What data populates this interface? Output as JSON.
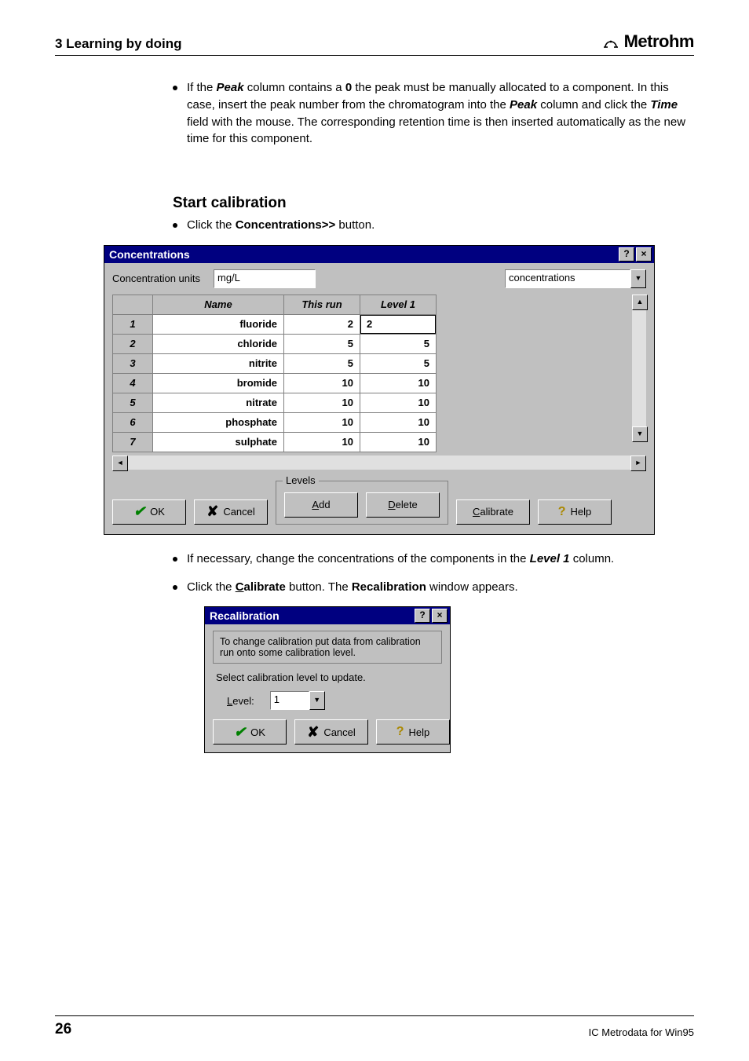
{
  "header": {
    "section": "3  Learning by doing",
    "brand": "Metrohm"
  },
  "para1": {
    "pre": "If the ",
    "peak": "Peak",
    "mid1": " column contains a ",
    "zero": "0",
    "mid2": " the peak must be manually allocated to a component. In this case, insert the peak number from the chromatogram into the ",
    "peak2": "Peak",
    "mid3": " column and click the ",
    "time": "Time",
    "end": " field with the mouse. The corresponding retention time is then inserted automatically as the new time for this component."
  },
  "heading1": "Start calibration",
  "bullet2": {
    "pre": "Click the ",
    "btn": "Concentrations>>",
    "post": " button."
  },
  "concentrations_dialog": {
    "title": "Concentrations",
    "units_label": "Concentration units",
    "units_value": "mg/L",
    "combo_value": "concentrations",
    "columns": [
      "",
      "Name",
      "This run",
      "Level 1"
    ],
    "rows": [
      {
        "idx": "1",
        "name": "fluoride",
        "thisrun": "2",
        "level1": "2"
      },
      {
        "idx": "2",
        "name": "chloride",
        "thisrun": "5",
        "level1": "5"
      },
      {
        "idx": "3",
        "name": "nitrite",
        "thisrun": "5",
        "level1": "5"
      },
      {
        "idx": "4",
        "name": "bromide",
        "thisrun": "10",
        "level1": "10"
      },
      {
        "idx": "5",
        "name": "nitrate",
        "thisrun": "10",
        "level1": "10"
      },
      {
        "idx": "6",
        "name": "phosphate",
        "thisrun": "10",
        "level1": "10"
      },
      {
        "idx": "7",
        "name": "sulphate",
        "thisrun": "10",
        "level1": "10"
      }
    ],
    "buttons": {
      "ok": "OK",
      "cancel": "Cancel",
      "levels_label": "Levels",
      "add": "Add",
      "delete": "Delete",
      "calibrate": "Calibrate",
      "help": "Help"
    }
  },
  "bullet3": {
    "pre": "If necessary, change the concentrations of the components in the ",
    "lvl": "Level 1",
    "post": " column."
  },
  "bullet4": {
    "pre": "Click the ",
    "btn_u": "C",
    "btn_rest": "alibrate",
    "mid": " button. The ",
    "recal": "Recalibration",
    "post": " window appears."
  },
  "recal_dialog": {
    "title": "Recalibration",
    "group_text": "To change calibration put data from calibration run onto some calibration level.",
    "select_text": "Select calibration level to update.",
    "level_label": "Level:",
    "level_value": "1",
    "buttons": {
      "ok": "OK",
      "cancel": "Cancel",
      "help": "Help"
    }
  },
  "footer": {
    "page": "26",
    "product": "IC Metrodata for Win95"
  }
}
